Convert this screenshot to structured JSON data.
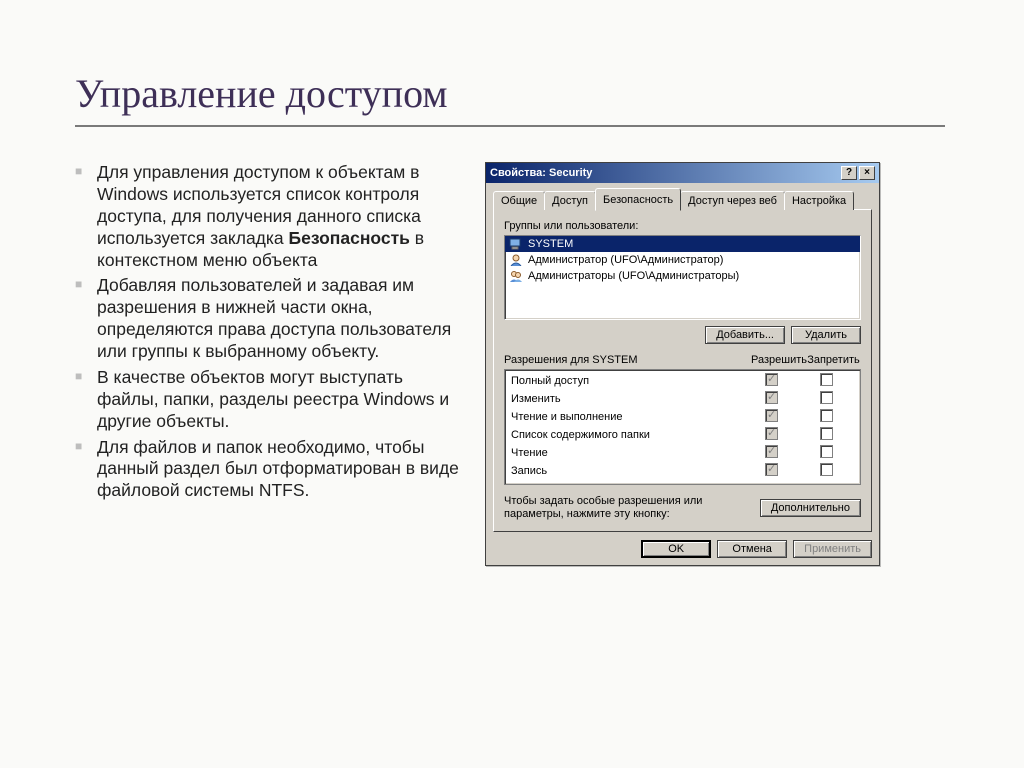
{
  "slide": {
    "title": "Управление доступом",
    "bullets": [
      "Для управления доступом к объектам в Windows используется список контроля доступа, для получения данного списка используется закладка <b>Безопасность</b> в контекстном меню объекта",
      "Добавляя пользователей и задавая им разрешения в нижней части окна, определяются права доступа пользователя или группы к выбранному объекту.",
      "В качестве объектов могут выступать файлы, папки, разделы реестра Windows и другие объекты.",
      "Для файлов и папок необходимо, чтобы данный раздел был отформатирован в виде файловой системы NTFS."
    ]
  },
  "dialog": {
    "title": "Свойства: Security",
    "help_btn": "?",
    "close_btn": "×",
    "tabs": [
      "Общие",
      "Доступ",
      "Безопасность",
      "Доступ через веб",
      "Настройка"
    ],
    "active_tab_index": 2,
    "groups_label": "Группы или пользователи:",
    "users": [
      {
        "name": "SYSTEM",
        "selected": true,
        "icon": "computer"
      },
      {
        "name": "Администратор (UFO\\Администратор)",
        "selected": false,
        "icon": "user"
      },
      {
        "name": "Администраторы (UFO\\Администраторы)",
        "selected": false,
        "icon": "group"
      }
    ],
    "add_btn": "Добавить...",
    "remove_btn": "Удалить",
    "perms_label": "Разрешения для SYSTEM",
    "allow_label": "Разрешить",
    "deny_label": "Запретить",
    "permissions": [
      {
        "name": "Полный доступ",
        "allow": true,
        "deny": false
      },
      {
        "name": "Изменить",
        "allow": true,
        "deny": false
      },
      {
        "name": "Чтение и выполнение",
        "allow": true,
        "deny": false
      },
      {
        "name": "Список содержимого папки",
        "allow": true,
        "deny": false
      },
      {
        "name": "Чтение",
        "allow": true,
        "deny": false
      },
      {
        "name": "Запись",
        "allow": true,
        "deny": false
      }
    ],
    "adv_text": "Чтобы задать особые разрешения или параметры, нажмите эту кнопку:",
    "adv_btn": "Дополнительно",
    "ok_btn": "OK",
    "cancel_btn": "Отмена",
    "apply_btn": "Применить"
  }
}
